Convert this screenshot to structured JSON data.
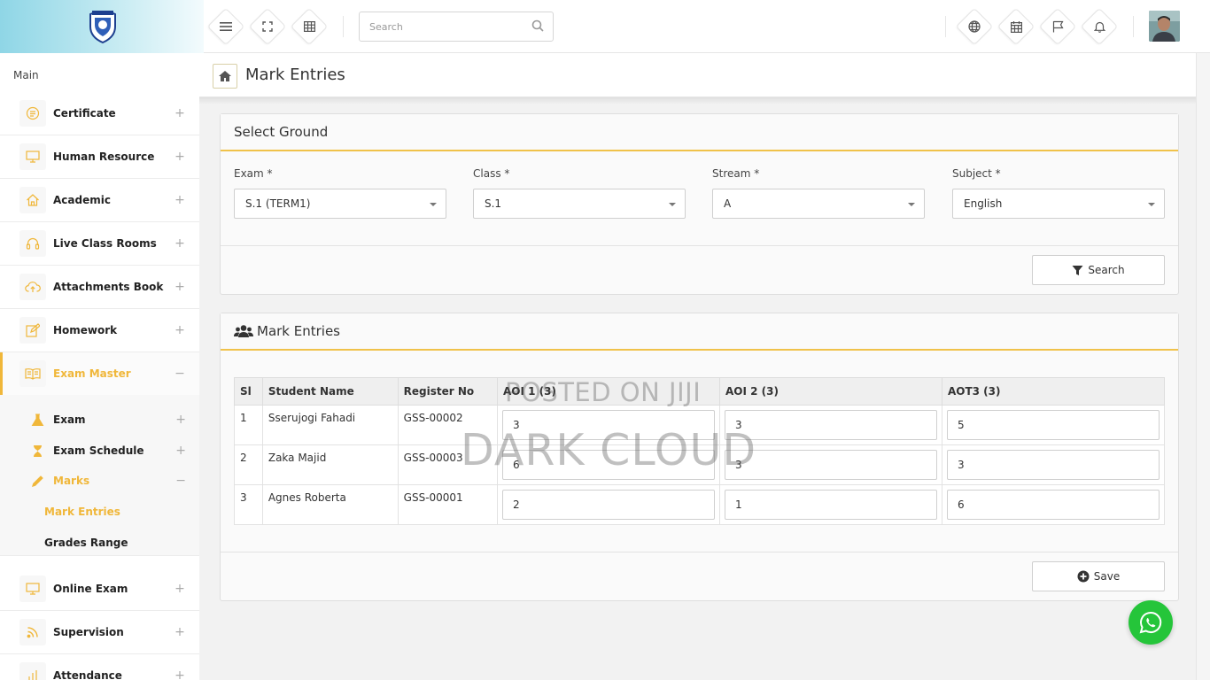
{
  "topbar": {
    "search_placeholder": "Search",
    "left_buttons": [
      "menu-icon",
      "fullscreen-icon",
      "grid-icon"
    ],
    "right_buttons": [
      "globe-icon",
      "calendar-icon",
      "flag-icon",
      "bell-icon"
    ]
  },
  "sidebar": {
    "section_label": "Main",
    "items": [
      {
        "label": "Certificate",
        "icon": "certificate-icon",
        "toggle": "+"
      },
      {
        "label": "Human Resource",
        "icon": "monitor-icon",
        "toggle": "+"
      },
      {
        "label": "Academic",
        "icon": "home-icon",
        "toggle": "+"
      },
      {
        "label": "Live Class Rooms",
        "icon": "headset-icon",
        "toggle": "+"
      },
      {
        "label": "Attachments Book",
        "icon": "cloud-upload-icon",
        "toggle": "+"
      },
      {
        "label": "Homework",
        "icon": "edit-icon",
        "toggle": "+"
      },
      {
        "label": "Exam Master",
        "icon": "book-icon",
        "toggle": "−"
      }
    ],
    "exam_sub": [
      {
        "label": "Exam",
        "icon": "flask-icon",
        "toggle": "+"
      },
      {
        "label": "Exam Schedule",
        "icon": "hourglass-icon",
        "toggle": "+"
      },
      {
        "label": "Marks",
        "icon": "pencil-icon",
        "toggle": "−"
      }
    ],
    "marks_sub": [
      "Mark Entries",
      "Grades Range"
    ],
    "items_after": [
      {
        "label": "Online Exam",
        "icon": "monitor-icon",
        "toggle": "+"
      },
      {
        "label": "Supervision",
        "icon": "rss-icon",
        "toggle": "+"
      },
      {
        "label": "Attendance",
        "icon": "chart-icon",
        "toggle": "+"
      }
    ]
  },
  "page": {
    "title": "Mark Entries"
  },
  "select_panel": {
    "title": "Select Ground",
    "fields": [
      {
        "label": "Exam *",
        "value": "S.1 (TERM1)"
      },
      {
        "label": "Class *",
        "value": "S.1"
      },
      {
        "label": "Stream *",
        "value": "A"
      },
      {
        "label": "Subject *",
        "value": "English"
      }
    ],
    "search_button": "Search"
  },
  "marks_panel": {
    "title": "Mark Entries",
    "headers": [
      "Sl",
      "Student Name",
      "Register No",
      "AOI 1 (3)",
      "AOI 2 (3)",
      "AOT3 (3)"
    ],
    "rows": [
      {
        "sl": "1",
        "name": "Sserujogi Fahadi",
        "reg": "GSS-00002",
        "aoi1": "3",
        "aoi2": "3",
        "aot3": "5"
      },
      {
        "sl": "2",
        "name": "Zaka Majid",
        "reg": "GSS-00003",
        "aoi1": "6",
        "aoi2": "3",
        "aot3": "3"
      },
      {
        "sl": "3",
        "name": "Agnes Roberta",
        "reg": "GSS-00001",
        "aoi1": "2",
        "aoi2": "1",
        "aot3": "6"
      }
    ],
    "save_button": "Save"
  },
  "watermark": {
    "line1": "POSTED ON JIJI",
    "line2": "DARK CLOUD"
  },
  "colors": {
    "accent": "#f0b73a",
    "whatsapp": "#25c53a"
  }
}
